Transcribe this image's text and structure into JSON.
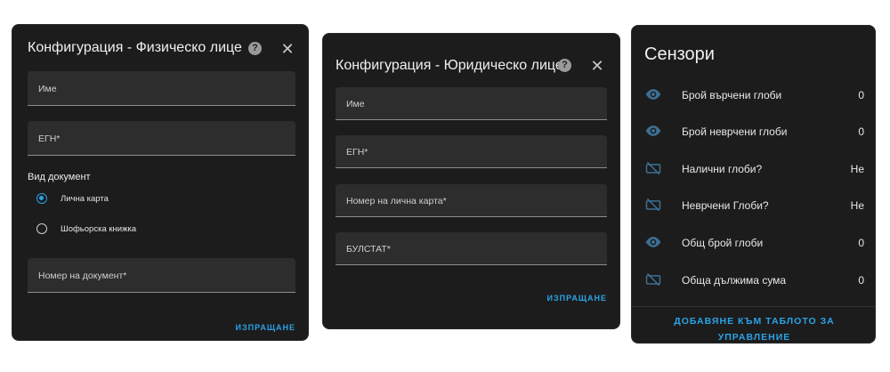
{
  "dialog_individual": {
    "title": "Конфигурация - Физическо лице",
    "fields": [
      "Име",
      "ЕГН*"
    ],
    "document_type_label": "Вид документ",
    "options": [
      {
        "label": "Лична карта",
        "selected": true
      },
      {
        "label": "Шофьорска книжка",
        "selected": false
      }
    ],
    "document_number_label": "Номер на документ*",
    "submit_label": "ИЗПРАЩАНЕ"
  },
  "dialog_company": {
    "title": "Конфигурация - Юридическо лице",
    "fields": [
      "Име",
      "ЕГН*",
      "Номер на лична карта*",
      "БУЛСТАТ*"
    ],
    "submit_label": "ИЗПРАЩАНЕ"
  },
  "sensors": {
    "title": "Сензори",
    "items": [
      {
        "icon": "eye-icon",
        "name": "Брой върчени глоби",
        "value": "0"
      },
      {
        "icon": "eye-icon",
        "name": "Брой неврчени глоби",
        "value": "0"
      },
      {
        "icon": "eye-off-icon",
        "name": "Налични глоби?",
        "value": "Не"
      },
      {
        "icon": "eye-off-icon",
        "name": "Неврчени Глоби?",
        "value": "Не"
      },
      {
        "icon": "eye-icon",
        "name": "Общ брой глоби",
        "value": "0"
      },
      {
        "icon": "eye-off-icon",
        "name": "Обща дължима сума",
        "value": "0"
      }
    ],
    "action_line1": "ДОБАВЯНЕ КЪМ ТАБЛОТО ЗА",
    "action_line2": "УПРАВЛЕНИЕ"
  },
  "colors": {
    "panel_bg": "#1c1c1c",
    "field_bg": "#2d2d2d",
    "accent": "#2aa3e8",
    "icon_blue": "#3d6f94"
  }
}
